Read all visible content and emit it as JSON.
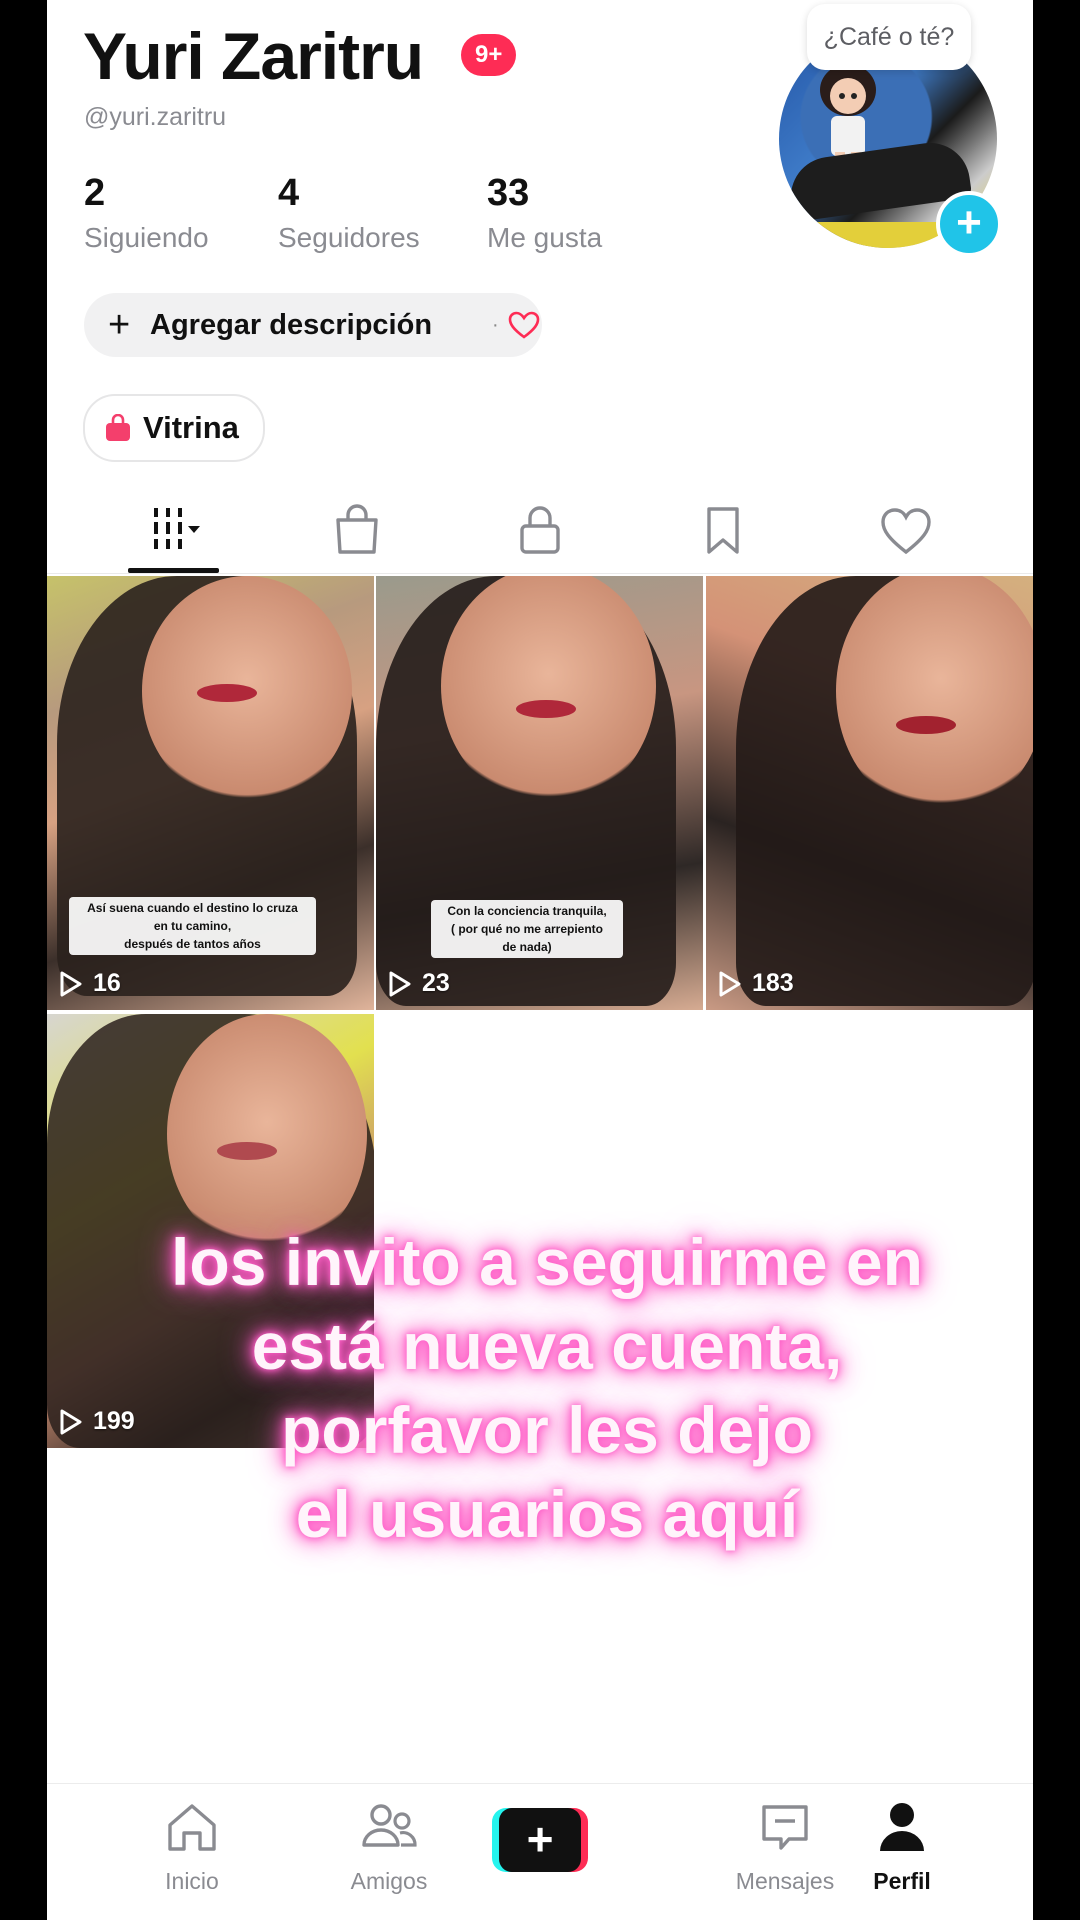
{
  "profile": {
    "name": "Yuri Zaritru",
    "notification_badge": "9+",
    "handle": "@yuri.zaritru",
    "stats": [
      {
        "value": "2",
        "label": "Siguiendo"
      },
      {
        "value": "4",
        "label": "Seguidores"
      },
      {
        "value": "33",
        "label": "Me gusta"
      }
    ],
    "cafe_bubble": "¿Café o té?",
    "add_description": "Agregar descripción",
    "separator": "·",
    "showcase": "Vitrina"
  },
  "tabs": [
    "videos-grid-icon",
    "shop-bag-icon",
    "lock-icon",
    "bookmark-icon",
    "heart-icon"
  ],
  "videos": [
    {
      "views": "16",
      "caption": [
        "Así suena cuando el destino lo cruza",
        "en tu camino,",
        "después de tantos años"
      ]
    },
    {
      "views": "23",
      "caption": [
        "Con la conciencia tranquila,",
        "( por qué no me arrepiento",
        "de nada)"
      ]
    },
    {
      "views": "183",
      "caption": []
    },
    {
      "views": "199",
      "caption": []
    }
  ],
  "overlay_text": [
    "los invito a seguirme en",
    "está nueva cuenta,",
    "porfavor les dejo",
    "el usuarios aquí"
  ],
  "nav": {
    "home": "Inicio",
    "friends": "Amigos",
    "create": "+",
    "inbox": "Mensajes",
    "profile": "Perfil"
  },
  "colors": {
    "accent": "#fe2c55",
    "cyan": "#25f4ee",
    "avatar_plus": "#20c4e8",
    "glow": "#ff5fc8"
  }
}
